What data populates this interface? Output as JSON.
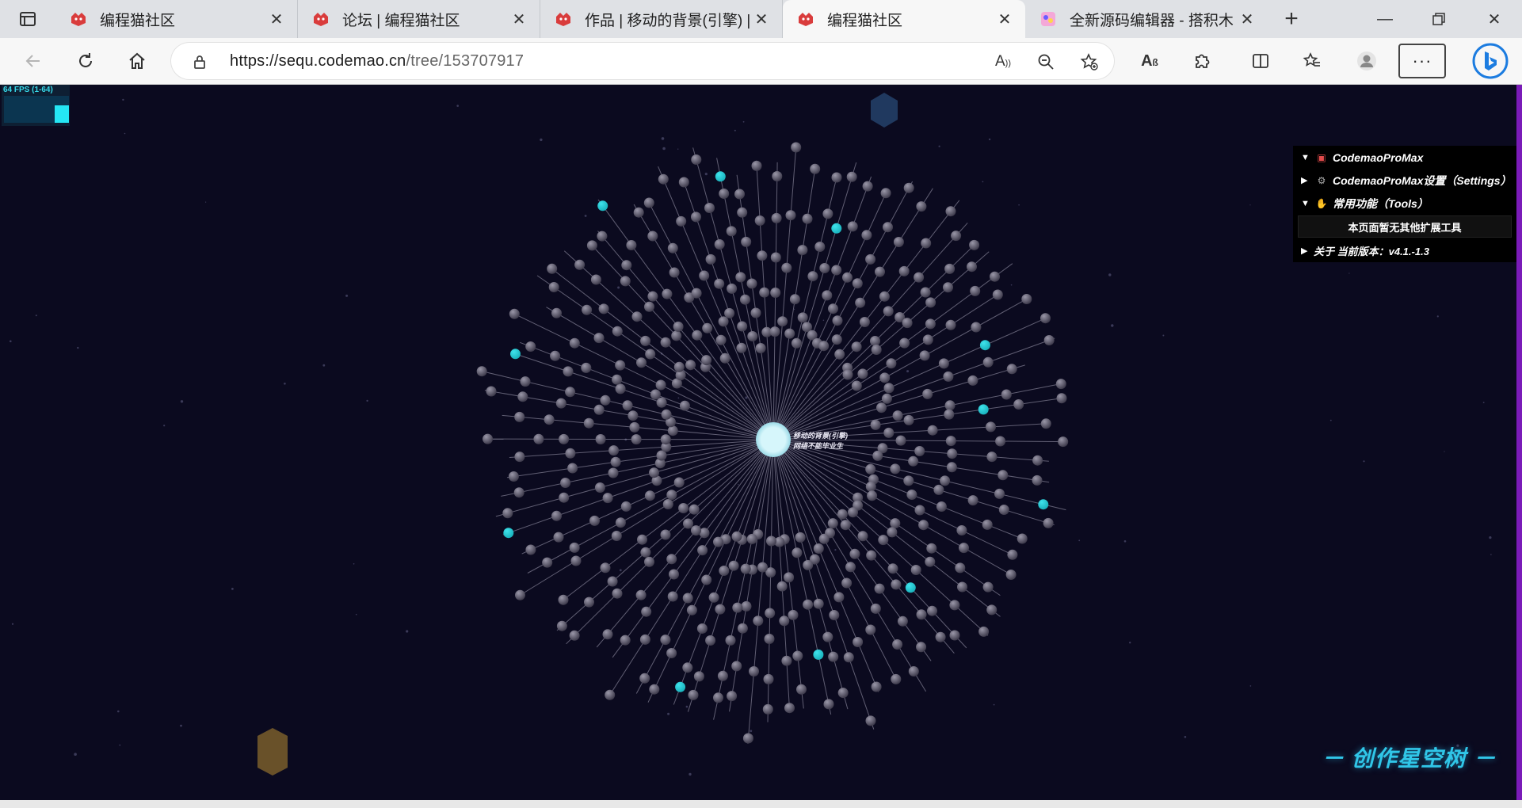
{
  "browser": {
    "tabs": [
      {
        "title": "编程猫社区",
        "active": false
      },
      {
        "title": "论坛 | 编程猫社区",
        "active": false
      },
      {
        "title": "作品 | 移动的背景(引擎) | 编",
        "active": false
      },
      {
        "title": "编程猫社区",
        "active": true
      },
      {
        "title": "全新源码编辑器 - 搭积木",
        "active": false
      }
    ],
    "url": {
      "host": "https://sequ.codemao.cn",
      "path": "/tree/153707917"
    }
  },
  "overlay": {
    "fps_text": "64 FPS (1-64)"
  },
  "extension_panel": {
    "items": [
      {
        "label": "CodemaoProMax",
        "expanded": true,
        "icon": "toolbox-icon"
      },
      {
        "label": "CodemaoProMax设置（Settings）",
        "expanded": false,
        "icon": "gear-icon"
      },
      {
        "label": "常用功能（Tools）",
        "expanded": true,
        "icon": "hand-icon"
      }
    ],
    "empty_text": "本页面暂无其他扩展工具",
    "about_label": "关于 当前版本：v4.1.-1.3"
  },
  "tree": {
    "center_title": "移动的背景(引擎)",
    "center_subtitle": "网络不能毕业生",
    "brand": "－ 创作星空树 －"
  },
  "colors": {
    "background": "#0b0a1f",
    "node": "#6b6878",
    "highlight_node": "#1ab3bd",
    "center_node": "#d6f6fb"
  }
}
